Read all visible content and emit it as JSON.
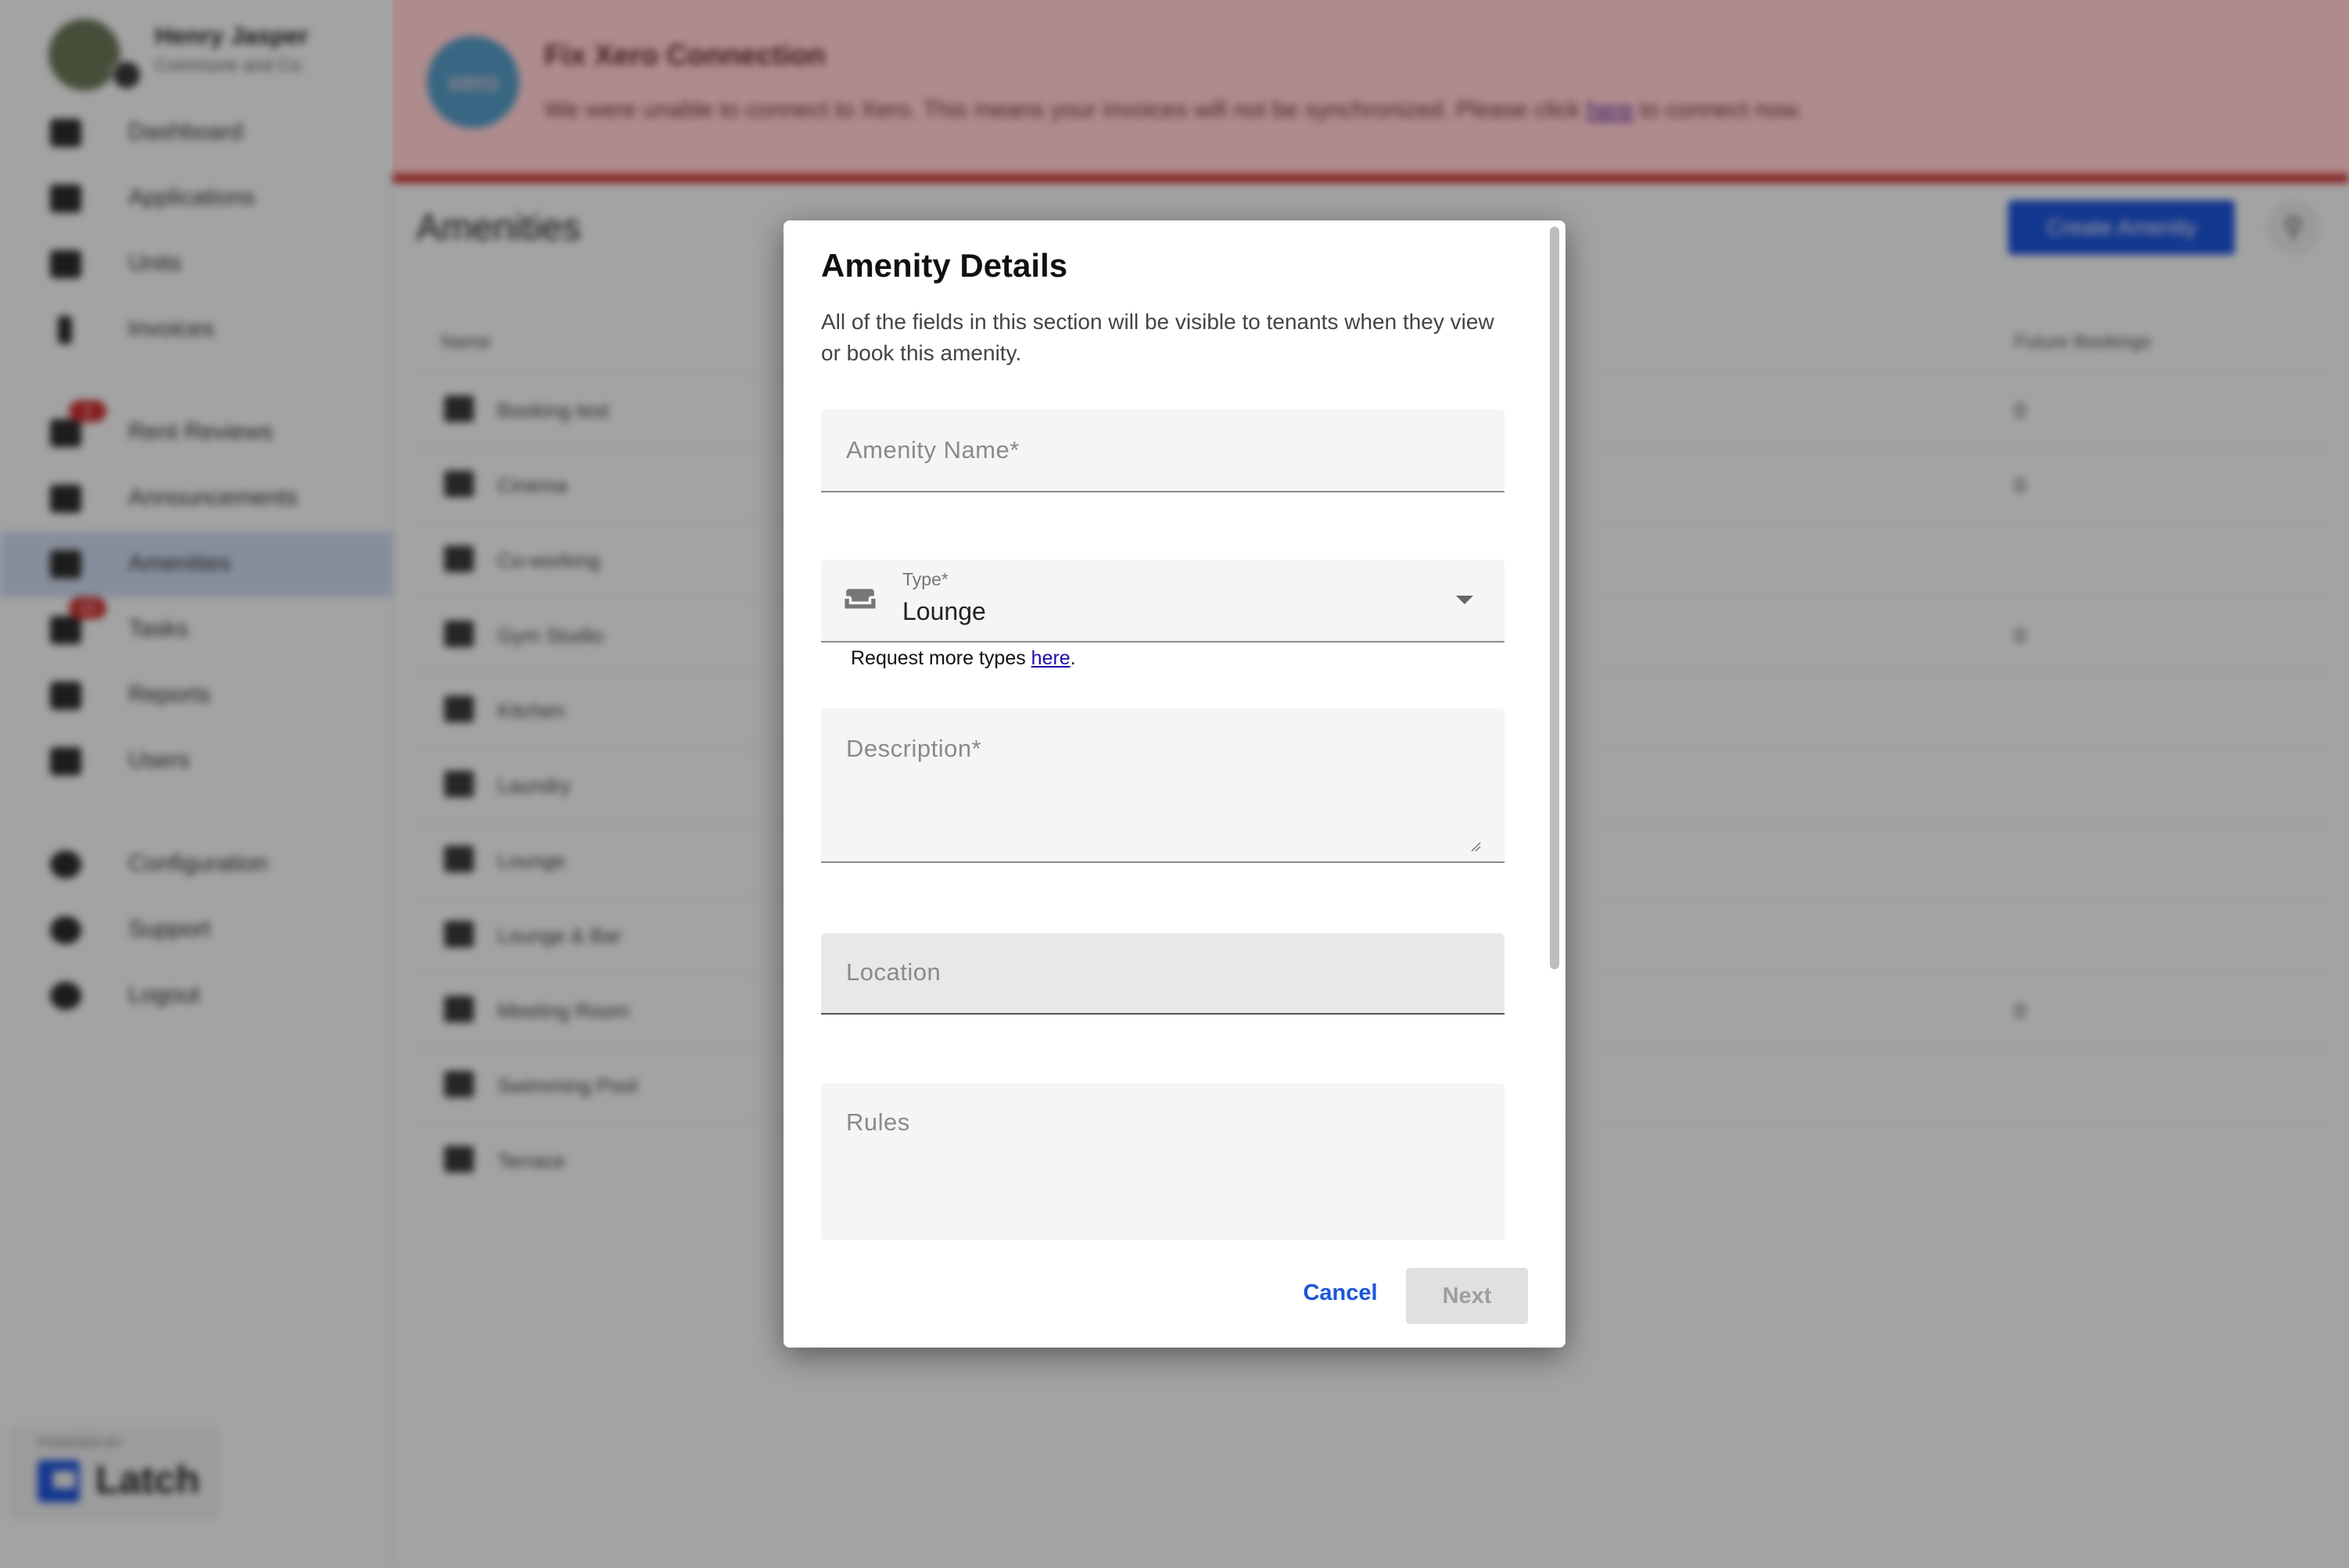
{
  "sidebar": {
    "user_name": "Henry Jasper",
    "company": "Commune and Co.",
    "items": [
      {
        "label": "Dashboard",
        "icon": "dashboard-icon"
      },
      {
        "label": "Applications",
        "icon": "applications-icon"
      },
      {
        "label": "Units",
        "icon": "units-icon"
      },
      {
        "label": "Invoices",
        "icon": "invoices-icon"
      },
      {
        "label": "Rent Reviews",
        "icon": "rent-reviews-icon",
        "badge": "1"
      },
      {
        "label": "Announcements",
        "icon": "announcements-icon"
      },
      {
        "label": "Amenities",
        "icon": "amenities-icon",
        "active": true
      },
      {
        "label": "Tasks",
        "icon": "tasks-icon",
        "badge": "12"
      },
      {
        "label": "Reports",
        "icon": "reports-icon"
      },
      {
        "label": "Users",
        "icon": "users-icon"
      },
      {
        "label": "Configuration",
        "icon": "gear-icon"
      },
      {
        "label": "Support",
        "icon": "help-icon"
      },
      {
        "label": "Logout",
        "icon": "logout-icon"
      }
    ],
    "powered_by": "POWERED BY",
    "brand": "Latch"
  },
  "banner": {
    "logo_text": "xero",
    "title": "Fix Xero Connection",
    "text_before": "We were unable to connect to Xero. This means your invoices will not be synchronized. Please click ",
    "link": "here",
    "text_after": " to connect now."
  },
  "page": {
    "title": "Amenities",
    "create_button": "Create Amenity"
  },
  "table": {
    "columns": [
      "Name",
      "Future Bookings"
    ],
    "rows": [
      {
        "name": "Booking test",
        "bookings": "0"
      },
      {
        "name": "Cinema",
        "bookings": "0"
      },
      {
        "name": "Co-working",
        "bookings": ""
      },
      {
        "name": "Gym Studio",
        "bookings": "0"
      },
      {
        "name": "Kitchen",
        "bookings": ""
      },
      {
        "name": "Laundry",
        "bookings": ""
      },
      {
        "name": "Lounge",
        "bookings": ""
      },
      {
        "name": "Lounge & Bar",
        "bookings": ""
      },
      {
        "name": "Meeting Room",
        "bookings": "0"
      },
      {
        "name": "Swimming Pool",
        "bookings": ""
      },
      {
        "name": "Terrace",
        "bookings": ""
      }
    ]
  },
  "dialog": {
    "title": "Amenity Details",
    "description": "All of the fields in this section will be visible to tenants when they view or book this amenity.",
    "amenity_name_placeholder": "Amenity Name*",
    "type_label": "Type*",
    "type_value": "Lounge",
    "type_icon": "sofa-icon",
    "helper_before": "Request more types ",
    "helper_link": "here",
    "helper_after": ".",
    "description_placeholder": "Description*",
    "location_placeholder": "Location",
    "rules_placeholder": "Rules",
    "cancel_label": "Cancel",
    "next_label": "Next"
  },
  "colors": {
    "primary": "#1f56e0",
    "error": "#d32f2f",
    "xero": "#13b5ea",
    "active_nav": "#d3dff3"
  }
}
